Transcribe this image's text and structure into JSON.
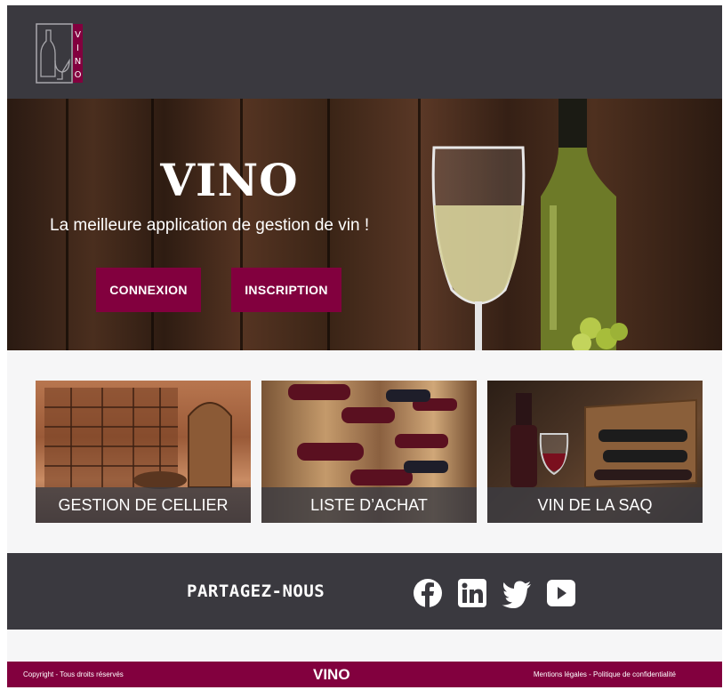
{
  "header": {
    "logo_text": "VINO"
  },
  "hero": {
    "title": "VINO",
    "subtitle": "La meilleure application de gestion de vin !",
    "login_label": "CONNEXION",
    "signup_label": "INSCRIPTION"
  },
  "cards": [
    {
      "label": "GESTION DE CELLIER"
    },
    {
      "label": "LISTE D’ACHAT"
    },
    {
      "label": "VIN DE LA SAQ"
    }
  ],
  "share": {
    "title": "PARTAGEZ-NOUS",
    "icons": [
      "facebook-icon",
      "linkedin-icon",
      "twitter-icon",
      "youtube-icon"
    ]
  },
  "footer": {
    "copyright": "Copyright - Tous droits réservés",
    "brand": "VINO",
    "legal": "Mentions légales - Politique de confidentialité"
  },
  "colors": {
    "accent": "#82003e",
    "dark": "#3a393f",
    "light_bg": "#f6f6f7"
  }
}
